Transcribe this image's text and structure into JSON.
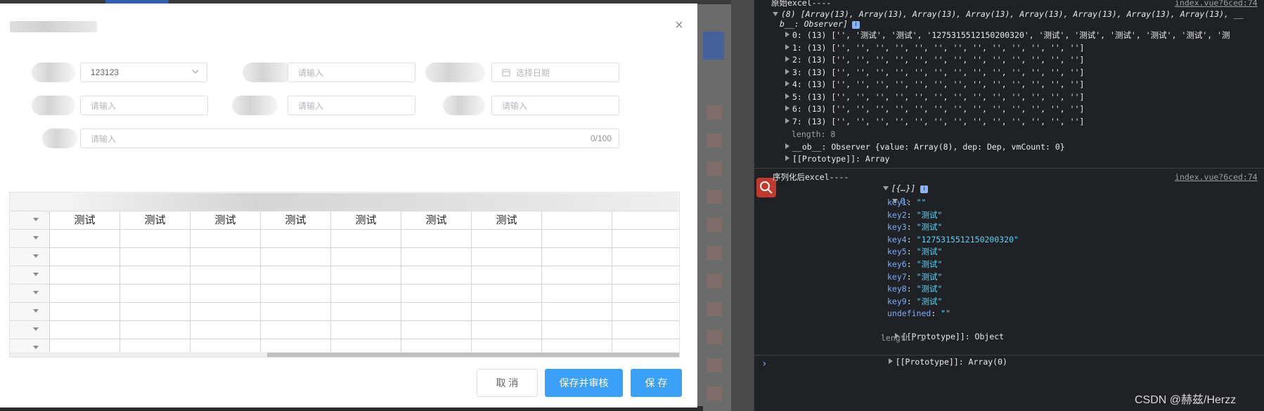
{
  "modal": {
    "close_label": "×",
    "fields": {
      "select_value": "123123",
      "input2_placeholder": "请输入",
      "date_placeholder": "选择日期",
      "input4_placeholder": "请输入",
      "input5_placeholder": "请输入",
      "input6_placeholder": "请输入",
      "textarea_placeholder": "请输入",
      "textarea_counter": "0/100"
    },
    "sheet": {
      "row1": [
        "测试",
        "测试",
        "测试",
        "测试",
        "测试",
        "测试",
        "测试",
        "",
        ""
      ],
      "empty_rows": 7
    },
    "buttons": {
      "cancel": "取 消",
      "save_review": "保存并审核",
      "save": "保 存"
    }
  },
  "console": {
    "lines": [
      {
        "text": "原始excel----",
        "cls": "c-plain"
      },
      {
        "text": "(8) [Array(13), Array(13), Array(13), Array(13), Array(13), Array(13), Array(13), Array(13), __",
        "cls": "c-plain"
      },
      {
        "text": "b__: Observer]",
        "cls": "c-plain"
      },
      {
        "text": "0: (13) ['', '测试', '测试', '1275315512150200320', '测试', '测试', '测试', '测试', '测试', '测",
        "cls": "c-plain"
      },
      {
        "text": "1: (13) ['', '', '', '', '', '', '', '', '', '', '', '', '']",
        "cls": "c-plain"
      },
      {
        "text": "2: (13) ['', '', '', '', '', '', '', '', '', '', '', '', '']",
        "cls": "c-plain"
      },
      {
        "text": "3: (13) ['', '', '', '', '', '', '', '', '', '', '', '', '']",
        "cls": "c-plain"
      },
      {
        "text": "4: (13) ['', '', '', '', '', '', '', '', '', '', '', '', '']",
        "cls": "c-plain"
      },
      {
        "text": "5: (13) ['', '', '', '', '', '', '', '', '', '', '', '', '']",
        "cls": "c-plain"
      },
      {
        "text": "6: (13) ['', '', '', '', '', '', '', '', '', '', '', '', '']",
        "cls": "c-plain"
      },
      {
        "text": "7: (13) ['', '', '', '', '', '', '', '', '', '', '', '', '']",
        "cls": "c-plain"
      },
      {
        "text": "length: 8",
        "cls": "c-plain"
      },
      {
        "text": "__ob__: Observer {value: Array(8), dep: Dep, vmCount: 0}",
        "cls": "c-plain"
      },
      {
        "text": "[[Prototype]]: Array",
        "cls": "c-plain"
      }
    ],
    "source_link_1": "index.vue?6ced:74",
    "serialized_label": "序列化后excel----",
    "serialized_head": "[{…}]",
    "source_link_2": "index.vue?6ced:74",
    "obj_index": "0:",
    "obj_keys": [
      {
        "k": "key1",
        "v": "\"\""
      },
      {
        "k": "key2",
        "v": "\"测试\""
      },
      {
        "k": "key3",
        "v": "\"测试\""
      },
      {
        "k": "key4",
        "v": "\"1275315512150200320\""
      },
      {
        "k": "key5",
        "v": "\"测试\""
      },
      {
        "k": "key6",
        "v": "\"测试\""
      },
      {
        "k": "key7",
        "v": "\"测试\""
      },
      {
        "k": "key8",
        "v": "\"测试\""
      },
      {
        "k": "key9",
        "v": "\"测试\""
      },
      {
        "k": "undefined",
        "v": "\"\""
      }
    ],
    "obj_proto": "[[Prototype]]: Object",
    "arr_length": "length: 1",
    "arr_proto": "[[Prototype]]: Array(0)",
    "prompt": "›",
    "watermark": "CSDN @赫兹/Herzz"
  },
  "colors": {
    "primary": "#3aa0f8",
    "console_bg": "#202124"
  }
}
